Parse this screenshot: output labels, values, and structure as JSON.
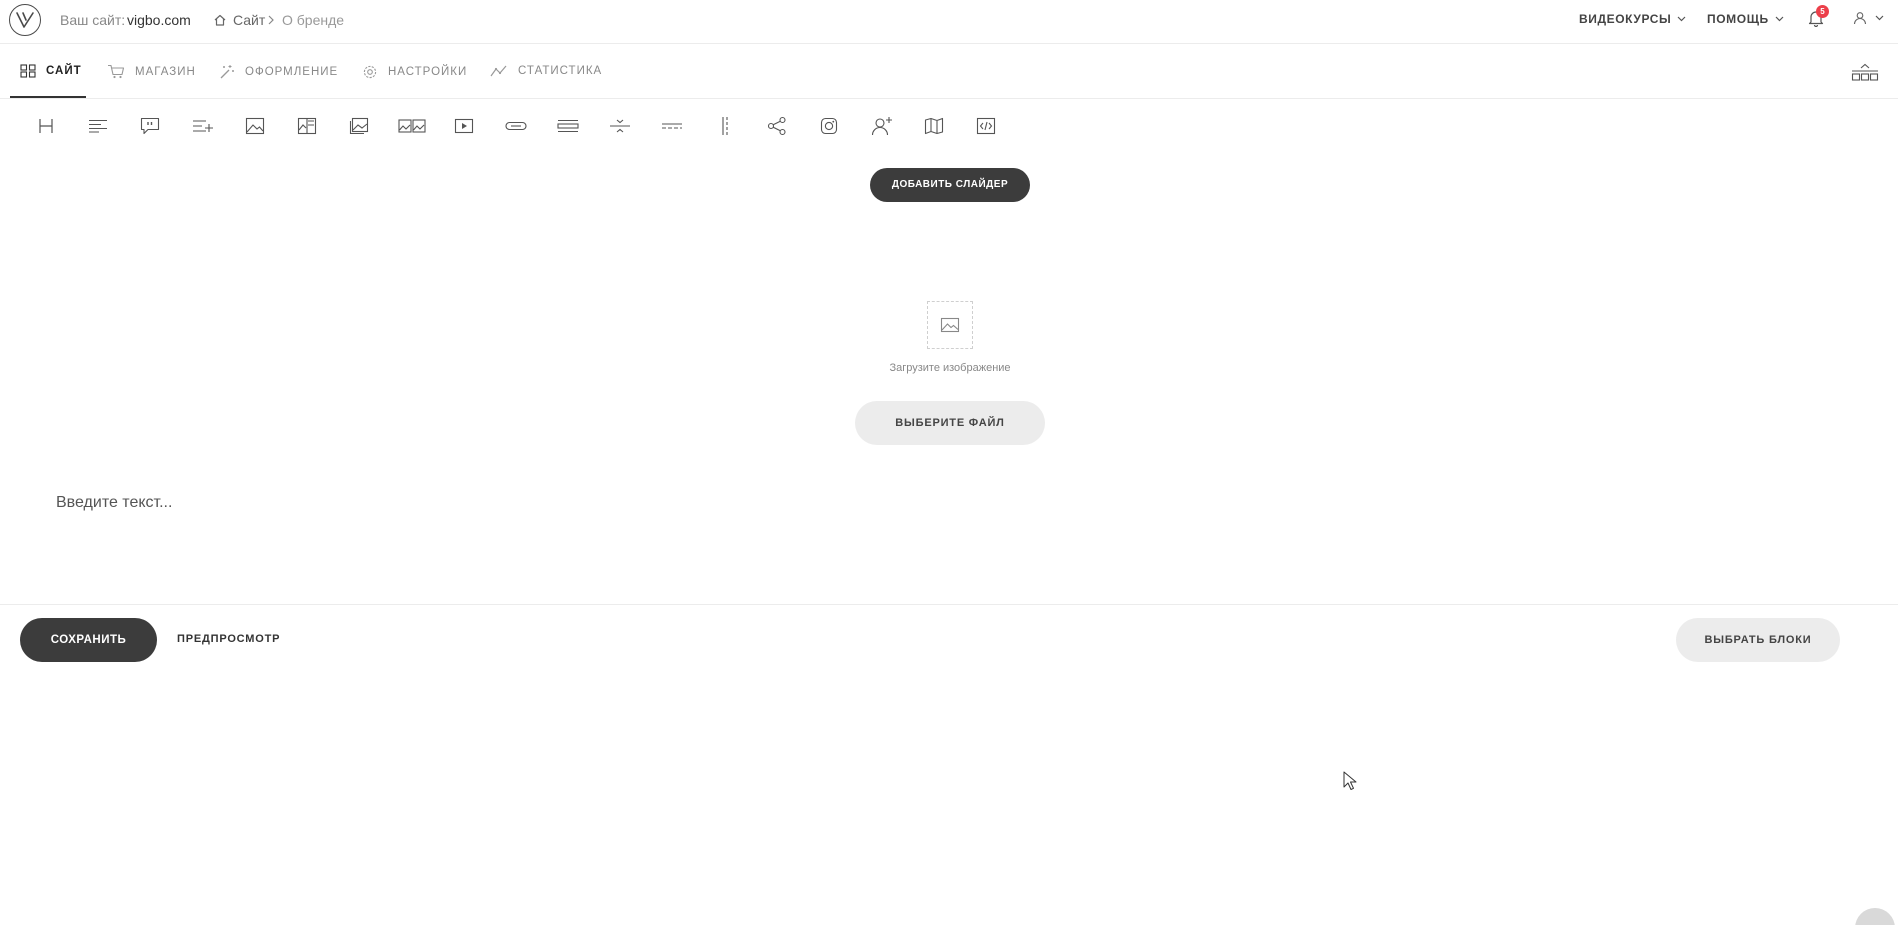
{
  "topbar": {
    "site_label": "Ваш сайт:",
    "site_domain": "vigbo.com",
    "breadcrumb": {
      "home": "Сайт",
      "current": "О бренде"
    },
    "menu_courses": "ВИДЕОКУРСЫ",
    "menu_help": "ПОМОЩЬ",
    "notifications_count": "5"
  },
  "tabs": [
    {
      "label": "САЙТ",
      "icon": "grid-icon",
      "active": true
    },
    {
      "label": "МАГАЗИН",
      "icon": "cart-icon",
      "active": false
    },
    {
      "label": "ОФОРМЛЕНИЕ",
      "icon": "magic-wand-icon",
      "active": false
    },
    {
      "label": "НАСТРОЙКИ",
      "icon": "gear-icon",
      "active": false
    },
    {
      "label": "СТАТИСТИКА",
      "icon": "chart-line-icon",
      "active": false
    }
  ],
  "block_tools": [
    "heading-icon",
    "text-icon",
    "quote-icon",
    "list-add-icon",
    "image-icon",
    "image-split-icon",
    "gallery-icon",
    "multi-image-icon",
    "video-icon",
    "button-icon",
    "lines-icon",
    "divider-icon",
    "dashed-divider-icon",
    "spacer-icon",
    "share-icon",
    "instagram-icon",
    "user-add-icon",
    "map-icon",
    "code-icon"
  ],
  "editor": {
    "add_slider": "ДОБАВИТЬ СЛАЙДЕР",
    "upload_prompt": "Загрузите изображение",
    "choose_file": "ВЫБЕРИТЕ ФАЙЛ",
    "text_placeholder": "Введите текст..."
  },
  "actions": {
    "save": "СОХРАНИТЬ",
    "preview": "ПРЕДПРОСМОТР",
    "choose_blocks": "ВЫБРАТЬ БЛОКИ"
  },
  "colors": {
    "primary_dark": "#3c3c3c",
    "badge": "#ec3f4a",
    "light_button": "#ececec"
  }
}
